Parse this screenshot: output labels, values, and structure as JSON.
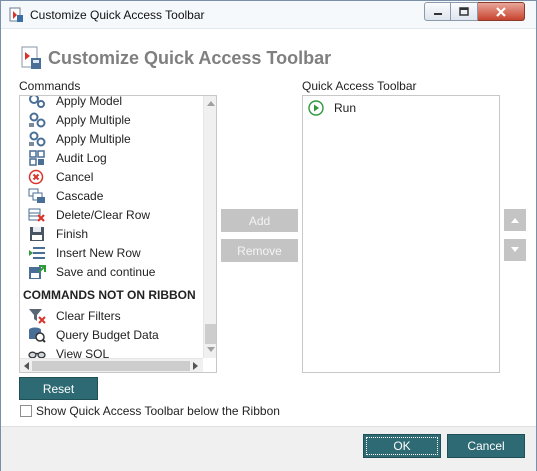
{
  "window": {
    "title": "Customize Quick Access Toolbar"
  },
  "heading": "Customize Quick Access Toolbar",
  "commands": {
    "label": "Commands",
    "items": [
      {
        "label": "Apply Model",
        "icon": "apply-model-icon"
      },
      {
        "label": "Apply Multiple",
        "icon": "apply-multiple-icon"
      },
      {
        "label": "Apply Multiple",
        "icon": "apply-multiple-icon"
      },
      {
        "label": "Audit Log",
        "icon": "audit-log-icon"
      },
      {
        "label": "Cancel",
        "icon": "cancel-icon"
      },
      {
        "label": "Cascade",
        "icon": "cascade-icon"
      },
      {
        "label": "Delete/Clear Row",
        "icon": "delete-row-icon"
      },
      {
        "label": "Finish",
        "icon": "save-disk-icon"
      },
      {
        "label": "Insert New Row",
        "icon": "insert-row-icon"
      },
      {
        "label": "Save and continue",
        "icon": "save-continue-icon"
      }
    ],
    "section_header": "COMMANDS NOT ON RIBBON",
    "other_items": [
      {
        "label": "Clear Filters",
        "icon": "clear-filter-icon"
      },
      {
        "label": "Query Budget Data",
        "icon": "query-data-icon"
      },
      {
        "label": "View SQL",
        "icon": "glasses-icon"
      }
    ]
  },
  "qat": {
    "label": "Quick Access Toolbar",
    "items": [
      {
        "label": "Run",
        "icon": "run-icon"
      }
    ]
  },
  "buttons": {
    "add": "Add",
    "remove": "Remove",
    "reset": "Reset",
    "ok": "OK",
    "cancel": "Cancel"
  },
  "show_below_ribbon": {
    "label": "Show Quick Access Toolbar below the Ribbon",
    "checked": false
  },
  "colors": {
    "accent": "#2e6a73",
    "disabled": "#c4c4c4",
    "heading": "#7f7f7f",
    "run_icon": "#2f9a3a",
    "cancel_icon": "#d9342b"
  }
}
